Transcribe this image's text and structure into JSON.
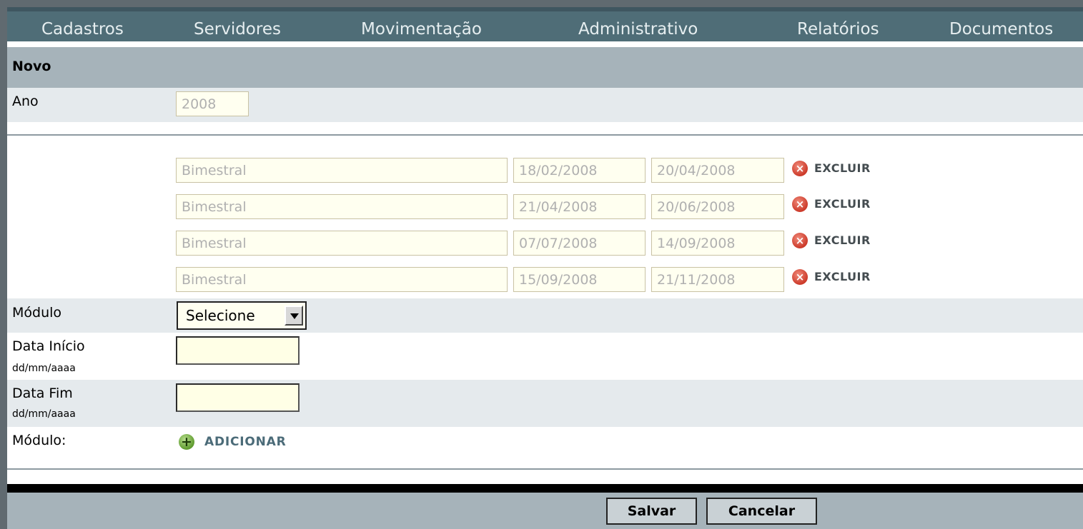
{
  "menu": {
    "items": [
      "Cadastros",
      "Servidores",
      "Movimentação",
      "Administrativo",
      "Relatórios",
      "Documentos"
    ]
  },
  "section_title": "Novo",
  "ano": {
    "label": "Ano",
    "value": "2008"
  },
  "modules": [
    {
      "tipo": "Bimestral",
      "inicio": "18/02/2008",
      "fim": "20/04/2008",
      "excluir": "EXCLUIR"
    },
    {
      "tipo": "Bimestral",
      "inicio": "21/04/2008",
      "fim": "20/06/2008",
      "excluir": "EXCLUIR"
    },
    {
      "tipo": "Bimestral",
      "inicio": "07/07/2008",
      "fim": "14/09/2008",
      "excluir": "EXCLUIR"
    },
    {
      "tipo": "Bimestral",
      "inicio": "15/09/2008",
      "fim": "21/11/2008",
      "excluir": "EXCLUIR"
    }
  ],
  "modulo": {
    "label": "Módulo",
    "selected": "Selecione"
  },
  "data_inicio": {
    "label": "Data Início",
    "hint": "dd/mm/aaaa",
    "value": ""
  },
  "data_fim": {
    "label": "Data Fim",
    "hint": "dd/mm/aaaa",
    "value": ""
  },
  "adicionar": {
    "label": "Módulo:",
    "button": "ADICIONAR"
  },
  "buttons": {
    "save": "Salvar",
    "cancel": "Cancelar"
  },
  "icons": {
    "excluir": "remove-icon",
    "adicionar": "add-icon",
    "select": "chevron-down-icon"
  },
  "colors": {
    "menu_bg": "#4f6d77",
    "header_bg": "#a6b3ba",
    "field_bg": "#fffff0",
    "excluir_red": "#cc3a2a",
    "add_green": "#5e9a2e"
  }
}
